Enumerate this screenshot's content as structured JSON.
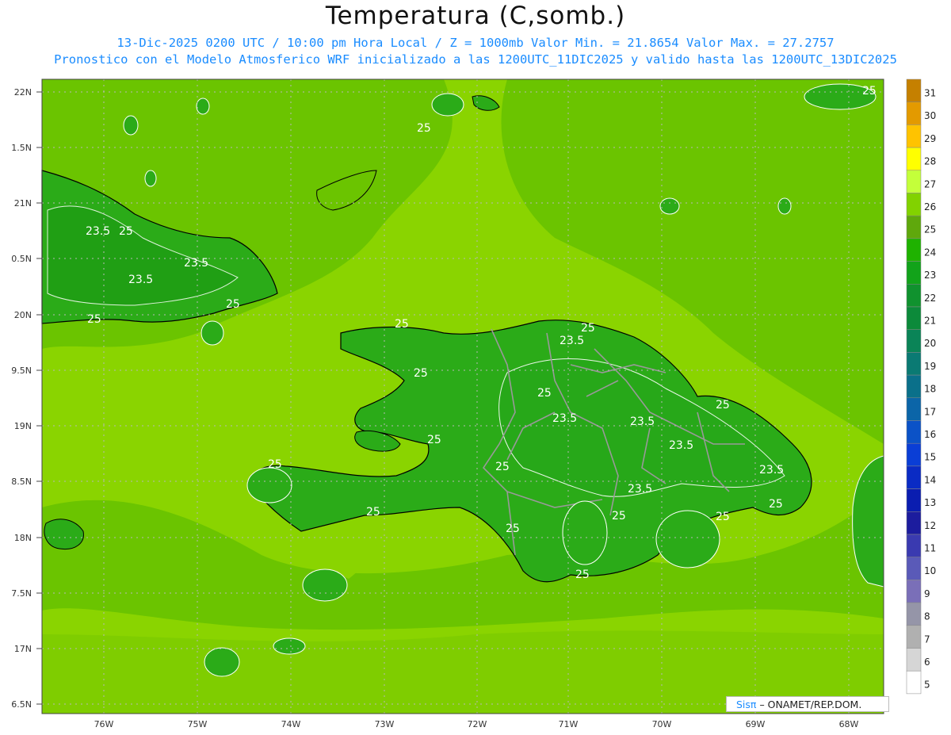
{
  "title": "Temperatura (C,somb.)",
  "subtitle_line1": "13-Dic-2025 0200 UTC / 10:00 pm Hora Local / Z = 1000mb  Valor Min. = 21.8654  Valor Max. = 27.2757",
  "subtitle_line2": "Pronostico con el Modelo Atmosferico WRF inicializado a las 1200UTC_11DIC2025 y valido hasta las  1200UTC_13DIC2025",
  "credit": {
    "brand": "Sisπ",
    "text": "– ONAMET/REP.DOM."
  },
  "lat_labels": [
    "22N",
    "1.5N",
    "21N",
    "0.5N",
    "20N",
    "9.5N",
    "19N",
    "8.5N",
    "18N",
    "7.5N",
    "17N",
    "6.5N"
  ],
  "lon_labels": [
    "76W",
    "75W",
    "74W",
    "73W",
    "72W",
    "71W",
    "70W",
    "69W",
    "68W"
  ],
  "contour_labels": [
    "25",
    "25",
    "23.5",
    "25",
    "23.5",
    "23.5",
    "25",
    "25",
    "25",
    "23.5",
    "25",
    "25",
    "25",
    "23.5",
    "23.5",
    "23.5",
    "23.5",
    "25",
    "25",
    "25",
    "25",
    "25",
    "25",
    "23.5",
    "25",
    "25",
    "25",
    "25"
  ],
  "colorbar": {
    "labels": [
      "31",
      "30",
      "29",
      "28",
      "27",
      "26",
      "25",
      "24",
      "23",
      "22",
      "21",
      "20",
      "19",
      "18",
      "17",
      "16",
      "15",
      "14",
      "13",
      "12",
      "11",
      "10",
      "9",
      "8",
      "7",
      "6",
      "5"
    ],
    "colors": [
      "#c58000",
      "#e39a00",
      "#ffc300",
      "#ffff00",
      "#c4ff3a",
      "#82d200",
      "#5fa80c",
      "#1fb200",
      "#12a31a",
      "#10922e",
      "#0c8a3a",
      "#0a8457",
      "#0a7a73",
      "#0a708a",
      "#0b65a8",
      "#0b52c7",
      "#0a3ed6",
      "#0a2bc4",
      "#0a1db0",
      "#1c1c9e",
      "#3a3ab0",
      "#5a5ab8",
      "#7a6fb8",
      "#9595a8",
      "#b0b0b0",
      "#d6d6d6",
      "#ffffff"
    ]
  },
  "map_colors": {
    "ocean": "#8ad400",
    "warm": "#6bc400",
    "land": "#2bab18",
    "coast": "#000000",
    "border": "#999999",
    "contour": "#ffffff"
  }
}
